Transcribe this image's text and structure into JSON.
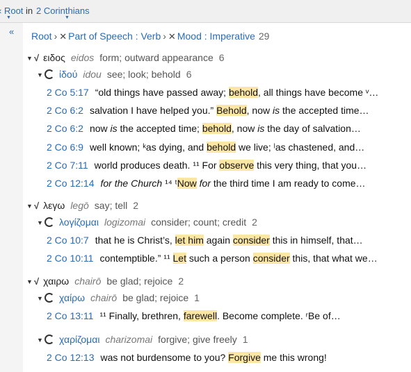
{
  "topbar": {
    "root_label": "Root",
    "in_label": "in",
    "book_label": "2 Corinthians"
  },
  "sidebar": {
    "collapse_glyph": "«"
  },
  "breadcrumb": {
    "root": "Root",
    "filter1": "Part of Speech : Verb",
    "filter2": "Mood : Imperative",
    "count": "29"
  },
  "groups": [
    {
      "root": {
        "greek": "ειδος",
        "translit": "eidos",
        "gloss": "form; outward appearance",
        "count": "6"
      },
      "lemmas": [
        {
          "greek": "ἰδού",
          "translit": "idou",
          "gloss": "see; look; behold",
          "count": "6",
          "verses": [
            {
              "ref": "2 Co 5:17",
              "segs": [
                {
                  "t": "“old things have passed away; "
                },
                {
                  "t": "behold",
                  "h": 1
                },
                {
                  "t": ", all things have become ᵛ…"
                }
              ]
            },
            {
              "ref": "2 Co 6:2",
              "segs": [
                {
                  "t": "salvation I have helped you.” "
                },
                {
                  "t": "Behold",
                  "h": 1
                },
                {
                  "t": ", now "
                },
                {
                  "t": "is",
                  "i": 1
                },
                {
                  "t": " the accepted time…"
                }
              ]
            },
            {
              "ref": "2 Co 6:2",
              "segs": [
                {
                  "t": "now "
                },
                {
                  "t": "is",
                  "i": 1
                },
                {
                  "t": " the accepted time; "
                },
                {
                  "t": "behold",
                  "h": 1
                },
                {
                  "t": ", now "
                },
                {
                  "t": "is",
                  "i": 1
                },
                {
                  "t": " the day of salvation…"
                }
              ]
            },
            {
              "ref": "2 Co 6:9",
              "segs": [
                {
                  "t": "well known; ᵏas dying, and "
                },
                {
                  "t": "behold",
                  "h": 1
                },
                {
                  "t": " we live; ˡas chastened, and…"
                }
              ]
            },
            {
              "ref": "2 Co 7:11",
              "segs": [
                {
                  "t": "world produces death. ¹¹ For "
                },
                {
                  "t": "observe",
                  "h": 1
                },
                {
                  "t": " this very thing, that you…"
                }
              ]
            },
            {
              "ref": "2 Co 12:14",
              "segs": [
                {
                  "t": "for the Church",
                  "i": 1
                },
                {
                  "t": " ¹⁴ ᵗ"
                },
                {
                  "t": "Now",
                  "h": 1
                },
                {
                  "t": " "
                },
                {
                  "t": "for",
                  "i": 1
                },
                {
                  "t": " the third time I am ready to come…"
                }
              ]
            }
          ]
        }
      ]
    },
    {
      "root": {
        "greek": "λεγω",
        "translit": "legō",
        "gloss": "say; tell",
        "count": "2"
      },
      "lemmas": [
        {
          "greek": "λογίζομαι",
          "translit": "logizomai",
          "gloss": "consider; count; credit",
          "count": "2",
          "verses": [
            {
              "ref": "2 Co 10:7",
              "segs": [
                {
                  "t": "that he is Christ’s, "
                },
                {
                  "t": "let him",
                  "h": 1
                },
                {
                  "t": " again "
                },
                {
                  "t": "consider",
                  "h": 1
                },
                {
                  "t": " this in himself, that…"
                }
              ]
            },
            {
              "ref": "2 Co 10:11",
              "segs": [
                {
                  "t": "contemptible.” ¹¹ "
                },
                {
                  "t": "Let",
                  "h": 1
                },
                {
                  "t": " such a person "
                },
                {
                  "t": "consider",
                  "h": 1
                },
                {
                  "t": " this, that what we…"
                }
              ]
            }
          ]
        }
      ]
    },
    {
      "root": {
        "greek": "χαιρω",
        "translit": "chairō",
        "gloss": "be glad; rejoice",
        "count": "2"
      },
      "lemmas": [
        {
          "greek": "χαίρω",
          "translit": "chairō",
          "gloss": "be glad; rejoice",
          "count": "1",
          "verses": [
            {
              "ref": "2 Co 13:11",
              "segs": [
                {
                  "t": "¹¹ Finally, brethren, "
                },
                {
                  "t": "farewell",
                  "h": 1
                },
                {
                  "t": ". Become complete. ʳBe of…"
                }
              ]
            }
          ]
        },
        {
          "greek": "χαρίζομαι",
          "translit": "charizomai",
          "gloss": "forgive; give freely",
          "count": "1",
          "verses": [
            {
              "ref": "2 Co 12:13",
              "segs": [
                {
                  "t": "was not burdensome to you? "
                },
                {
                  "t": "Forgive",
                  "h": 1
                },
                {
                  "t": " me this wrong!"
                }
              ]
            }
          ]
        }
      ]
    }
  ]
}
